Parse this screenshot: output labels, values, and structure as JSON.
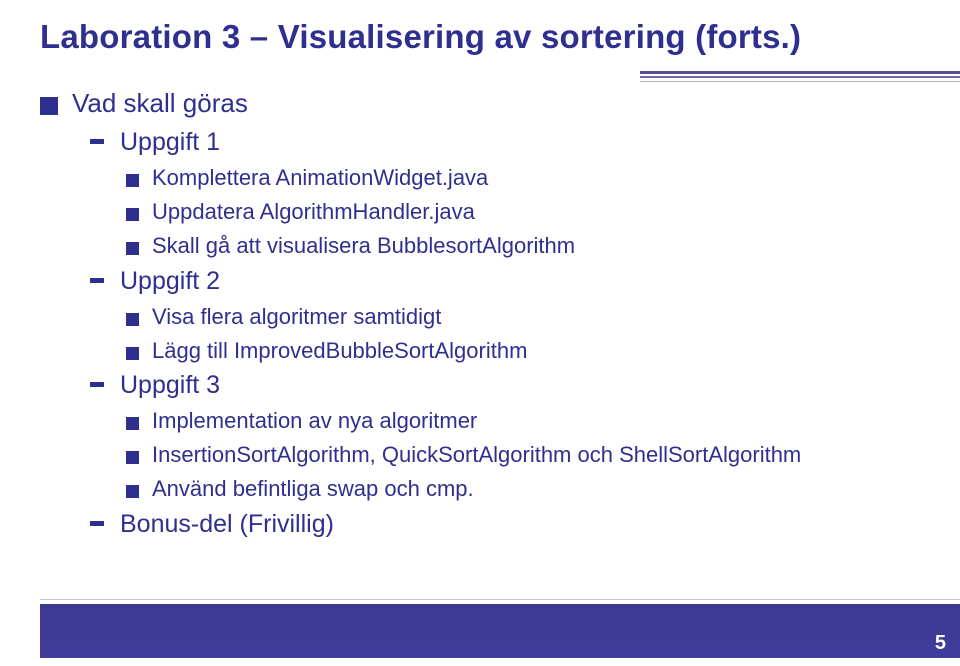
{
  "title": "Laboration 3 – Visualisering av sortering (forts.)",
  "pageNumber": "5",
  "l1": {
    "text": "Vad skall göras"
  },
  "u1": {
    "label": "Uppgift 1",
    "a": "Komplettera AnimationWidget.java",
    "b": "Uppdatera AlgorithmHandler.java",
    "c": "Skall gå att visualisera BubblesortAlgorithm"
  },
  "u2": {
    "label": "Uppgift 2",
    "a": "Visa flera algoritmer samtidigt",
    "b": "Lägg till ImprovedBubbleSortAlgorithm"
  },
  "u3": {
    "label": "Uppgift 3",
    "a": "Implementation av nya algoritmer",
    "b": "InsertionSortAlgorithm, QuickSortAlgorithm och ShellSortAlgorithm",
    "c": "Använd befintliga swap och cmp."
  },
  "bonus": {
    "label": "Bonus-del (Frivillig)"
  }
}
